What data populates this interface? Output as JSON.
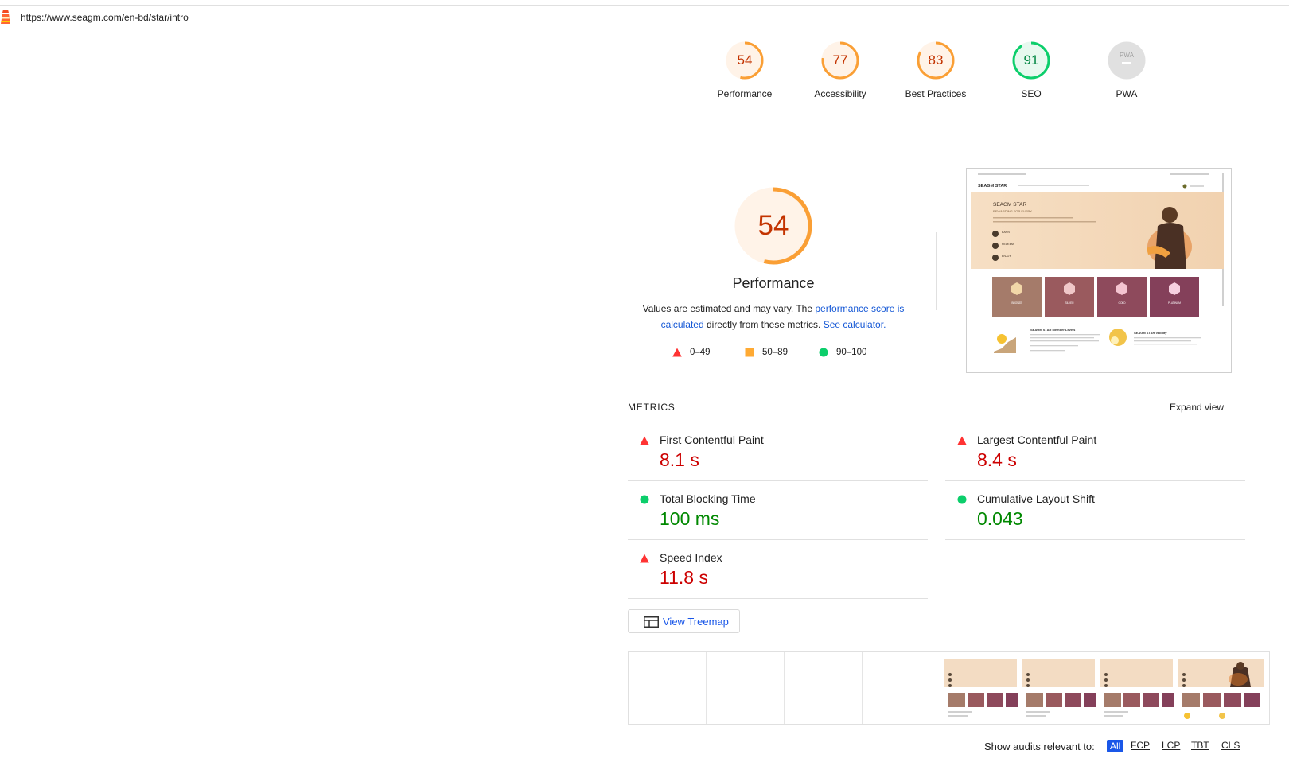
{
  "url_bar": {
    "url": "https://www.seagm.com/en-bd/star/intro"
  },
  "categories": [
    {
      "score": "54",
      "label": "Performance",
      "fraction": 0.54,
      "color": "#fa9f35",
      "text_color": "#c33300",
      "bg": "#fff3e8"
    },
    {
      "score": "77",
      "label": "Accessibility",
      "fraction": 0.77,
      "color": "#fa9f35",
      "text_color": "#c33300",
      "bg": "#fff3e8"
    },
    {
      "score": "83",
      "label": "Best Practices",
      "fraction": 0.83,
      "color": "#fa9f35",
      "text_color": "#c33300",
      "bg": "#fff3e8"
    },
    {
      "score": "91",
      "label": "SEO",
      "fraction": 0.91,
      "color": "#0cce6b",
      "text_color": "#018642",
      "bg": "#e7f9ef"
    },
    {
      "score": "",
      "label": "PWA",
      "fraction": 0,
      "color": "#cccccc",
      "text_color": "#ffffff",
      "bg": "#e0e0e0",
      "badge": "PWA"
    }
  ],
  "performance": {
    "score": "54",
    "fraction": 0.54,
    "title": "Performance",
    "desc_prefix": "Values are estimated and may vary. The ",
    "link1": "performance score is calculated",
    "desc_mid": " directly from these metrics. ",
    "link2": "See calculator.",
    "legend": [
      {
        "icon": "triangle",
        "range": "0–49",
        "color": "#ff3333"
      },
      {
        "icon": "square",
        "range": "50–89",
        "color": "#ffaa33"
      },
      {
        "icon": "circle",
        "range": "90–100",
        "color": "#0cce6b"
      }
    ]
  },
  "final_screenshot": {
    "brand": "SEAGM STAR",
    "headline": "SEAGM STAR",
    "subline": "REWARDING FOR EVERY",
    "steps": [
      "EARN",
      "REDEEM",
      "ENJOY"
    ],
    "tiers": [
      "BRONZE",
      "SILVER",
      "GOLD",
      "PLATINUM"
    ],
    "bottom_title_1": "SEAGM STAR Member Levels",
    "bottom_title_2": "SEAGM STAR Validity"
  },
  "metrics": {
    "title": "METRICS",
    "expand": "Expand view",
    "items": [
      {
        "name": "First Contentful Paint",
        "value": "8.1 s",
        "status": "fail"
      },
      {
        "name": "Largest Contentful Paint",
        "value": "8.4 s",
        "status": "fail"
      },
      {
        "name": "Total Blocking Time",
        "value": "100 ms",
        "status": "pass"
      },
      {
        "name": "Cumulative Layout Shift",
        "value": "0.043",
        "status": "pass"
      },
      {
        "name": "Speed Index",
        "value": "11.8 s",
        "status": "fail"
      }
    ]
  },
  "treemap_button": "View Treemap",
  "filmstrip": {
    "blank_frames": 4,
    "loaded_frames": 4
  },
  "audit_filter": {
    "label": "Show audits relevant to:",
    "chips": [
      "All",
      "FCP",
      "LCP",
      "TBT",
      "CLS"
    ],
    "selected": "All"
  }
}
